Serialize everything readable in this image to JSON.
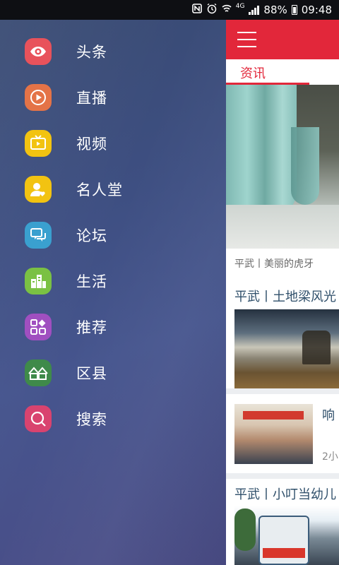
{
  "status_bar": {
    "battery": "88%",
    "time": "09:48",
    "network": "4G"
  },
  "drawer": {
    "items": [
      {
        "label": "头条",
        "icon": "eye-icon",
        "color": "#e8525b"
      },
      {
        "label": "直播",
        "icon": "play-icon",
        "color": "#e47347"
      },
      {
        "label": "视频",
        "icon": "tv-icon",
        "color": "#f2c311"
      },
      {
        "label": "名人堂",
        "icon": "person-heart-icon",
        "color": "#f2c311"
      },
      {
        "label": "论坛",
        "icon": "chat-icon",
        "color": "#3aa0cf"
      },
      {
        "label": "生活",
        "icon": "city-icon",
        "color": "#7ac143"
      },
      {
        "label": "推荐",
        "icon": "apps-icon",
        "color": "#a04fc0"
      },
      {
        "label": "区县",
        "icon": "houses-icon",
        "color": "#3f8a4a"
      },
      {
        "label": "搜索",
        "icon": "search-icon",
        "color": "#d9436f"
      }
    ]
  },
  "content": {
    "tab_active": "资讯",
    "articles": [
      {
        "caption": "平武丨美丽的虎牙"
      },
      {
        "title": "平武丨土地梁风光"
      },
      {
        "title": "响",
        "time": "2小"
      },
      {
        "title": "平武丨小叮当幼儿"
      }
    ]
  },
  "colors": {
    "accent": "#e2273a"
  }
}
